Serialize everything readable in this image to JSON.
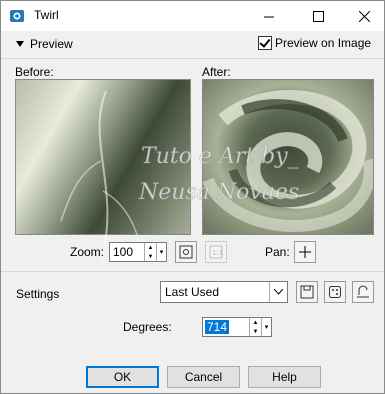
{
  "window": {
    "title": "Twirl"
  },
  "preview": {
    "toggle_label": "Preview",
    "preview_on_image_label": "Preview on Image",
    "preview_on_image_checked": true
  },
  "panes": {
    "before_label": "Before:",
    "after_label": "After:"
  },
  "zoom": {
    "label": "Zoom:",
    "value": "100"
  },
  "pan": {
    "label": "Pan:"
  },
  "watermark": {
    "line1": "Tuto e Art by_",
    "line2": "Neusa Novaes"
  },
  "settings": {
    "label": "Settings",
    "selected": "Last Used"
  },
  "degrees": {
    "label": "Degrees:",
    "value": "714"
  },
  "buttons": {
    "ok": "OK",
    "cancel": "Cancel",
    "help": "Help"
  },
  "colors": {
    "accent": "#0078d7",
    "title_icon": "#1e7fb8",
    "preview_green": "#6f7a62"
  }
}
